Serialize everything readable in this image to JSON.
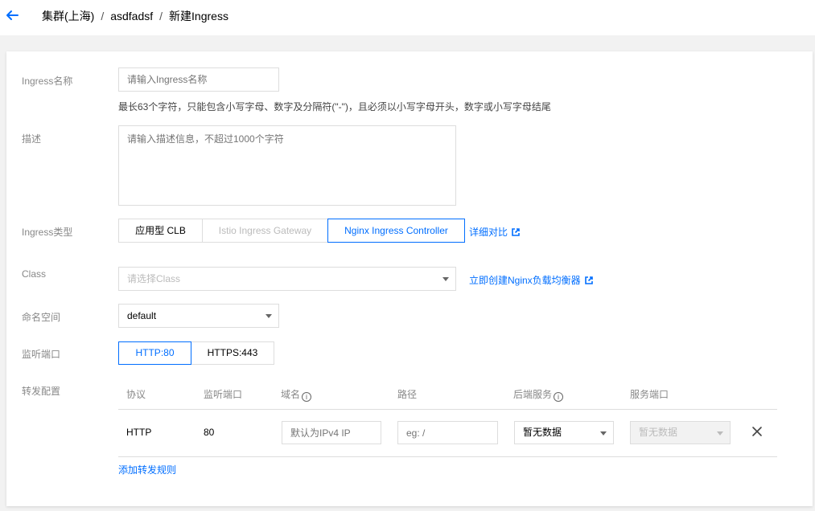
{
  "breadcrumb": {
    "cluster": "集群(上海)",
    "namespace_path": "asdfadsf",
    "page": "新建Ingress"
  },
  "form": {
    "name": {
      "label": "Ingress名称",
      "placeholder": "请输入Ingress名称",
      "tip": "最长63个字符，只能包含小写字母、数字及分隔符(\"-\")，且必须以小写字母开头，数字或小写字母结尾"
    },
    "description": {
      "label": "描述",
      "placeholder": "请输入描述信息，不超过1000个字符"
    },
    "type": {
      "label": "Ingress类型",
      "options": [
        "应用型 CLB",
        "Istio Ingress Gateway",
        "Nginx Ingress Controller"
      ],
      "selected": "Nginx Ingress Controller",
      "compare_link": "详细对比"
    },
    "class": {
      "label": "Class",
      "placeholder": "请选择Class",
      "create_link": "立即创建Nginx负载均衡器"
    },
    "namespace": {
      "label": "命名空间",
      "value": "default"
    },
    "listen_port": {
      "label": "监听端口",
      "options": [
        "HTTP:80",
        "HTTPS:443"
      ],
      "selected": "HTTP:80"
    },
    "forwarding": {
      "label": "转发配置",
      "columns": [
        "协议",
        "监听端口",
        "域名",
        "路径",
        "后端服务",
        "服务端口"
      ],
      "rows": [
        {
          "protocol": "HTTP",
          "port": "80",
          "domain_placeholder": "默认为IPv4 IP",
          "path_placeholder": "eg: /",
          "backend_service": "暂无数据",
          "service_port": "暂无数据"
        }
      ],
      "add_rule": "添加转发规则"
    }
  },
  "colors": {
    "primary": "#006eff",
    "border": "#dddddd",
    "label": "#888888",
    "background": "#f2f2f2"
  },
  "icons": {
    "back": "arrow-left-icon",
    "external": "external-link-icon",
    "info": "info-icon",
    "close": "close-icon"
  }
}
